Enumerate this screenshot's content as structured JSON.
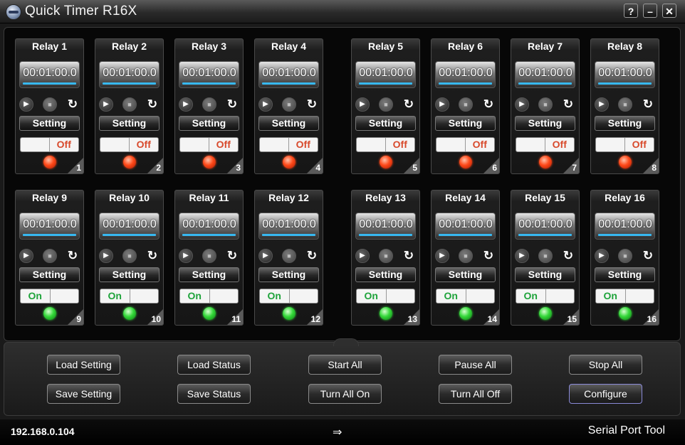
{
  "window": {
    "title": "Quick Timer R16X",
    "help_label": "?",
    "minimize_label": "–",
    "close_label": "✕"
  },
  "relays": [
    {
      "name": "Relay 1",
      "time": "00:01:00.0",
      "setting_label": "Setting",
      "state": "Off",
      "number": "1"
    },
    {
      "name": "Relay 2",
      "time": "00:01:00.0",
      "setting_label": "Setting",
      "state": "Off",
      "number": "2"
    },
    {
      "name": "Relay 3",
      "time": "00:01:00.0",
      "setting_label": "Setting",
      "state": "Off",
      "number": "3"
    },
    {
      "name": "Relay 4",
      "time": "00:01:00.0",
      "setting_label": "Setting",
      "state": "Off",
      "number": "4"
    },
    {
      "name": "Relay 5",
      "time": "00:01:00.0",
      "setting_label": "Setting",
      "state": "Off",
      "number": "5"
    },
    {
      "name": "Relay 6",
      "time": "00:01:00.0",
      "setting_label": "Setting",
      "state": "Off",
      "number": "6"
    },
    {
      "name": "Relay 7",
      "time": "00:01:00.0",
      "setting_label": "Setting",
      "state": "Off",
      "number": "7"
    },
    {
      "name": "Relay 8",
      "time": "00:01:00.0",
      "setting_label": "Setting",
      "state": "Off",
      "number": "8"
    },
    {
      "name": "Relay 9",
      "time": "00:01:00.0",
      "setting_label": "Setting",
      "state": "On",
      "number": "9"
    },
    {
      "name": "Relay 10",
      "time": "00:01:00.0",
      "setting_label": "Setting",
      "state": "On",
      "number": "10"
    },
    {
      "name": "Relay 11",
      "time": "00:01:00.0",
      "setting_label": "Setting",
      "state": "On",
      "number": "11"
    },
    {
      "name": "Relay 12",
      "time": "00:01:00.0",
      "setting_label": "Setting",
      "state": "On",
      "number": "12"
    },
    {
      "name": "Relay 13",
      "time": "00:01:00.0",
      "setting_label": "Setting",
      "state": "On",
      "number": "13"
    },
    {
      "name": "Relay 14",
      "time": "00:01:00.0",
      "setting_label": "Setting",
      "state": "On",
      "number": "14"
    },
    {
      "name": "Relay 15",
      "time": "00:01:00.0",
      "setting_label": "Setting",
      "state": "On",
      "number": "15"
    },
    {
      "name": "Relay 16",
      "time": "00:01:00.0",
      "setting_label": "Setting",
      "state": "On",
      "number": "16"
    }
  ],
  "controls": {
    "play_icon": "play-icon",
    "stop_icon": "stop-icon",
    "reset_icon": "reset-icon"
  },
  "buttons": {
    "load_setting": "Load Setting",
    "load_status": "Load Status",
    "start_all": "Start All",
    "pause_all": "Pause All",
    "stop_all": "Stop All",
    "save_setting": "Save Setting",
    "save_status": "Save Status",
    "turn_all_on": "Turn All On",
    "turn_all_off": "Turn All Off",
    "configure": "Configure"
  },
  "status": {
    "ip": "192.168.0.104",
    "port_tool": "Serial Port Tool",
    "arrow_icon": "connection-arrow-icon"
  },
  "colors": {
    "led_off": "#ff4a1a",
    "led_on": "#35d83a",
    "off_text": "#d84a2c",
    "on_text": "#1ea33a",
    "lcd_bar": "#37b8f0"
  }
}
